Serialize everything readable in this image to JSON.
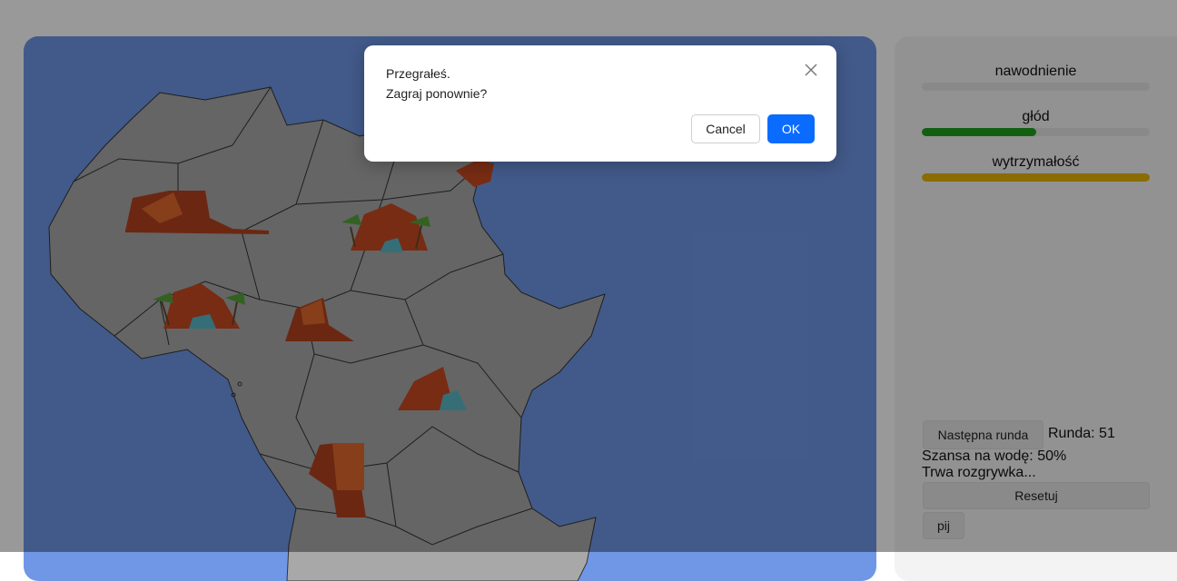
{
  "stats": [
    {
      "label": "nawodnienie",
      "level": 0.0,
      "color": "#e4e4e4"
    },
    {
      "label": "głód",
      "level": 0.5,
      "color": "#1f9e1f"
    },
    {
      "label": "wytrzymałość",
      "level": 1.0,
      "color": "#e8b400"
    }
  ],
  "controls": {
    "next_round_label": "Następna runda",
    "round_text": "Runda: 51",
    "water_chance_text": "Szansa na wodę: 50%",
    "status_text": "Trwa rozgrywka...",
    "reset_label": "Resetuj",
    "drink_label": "pij"
  },
  "map": {
    "ocean_color": "#6f97e6",
    "land_color": "#a8a8a8",
    "markers": [
      "desert-mesa-icon",
      "oasis-icon",
      "oasis-icon",
      "desert-mesa-icon",
      "oasis-icon",
      "desert-mesa-icon",
      "rock-icon"
    ]
  },
  "dialog": {
    "line1": "Przegrałeś.",
    "line2": "Zagraj ponownie?",
    "cancel_label": "Cancel",
    "ok_label": "OK",
    "close_icon": "close-icon"
  }
}
